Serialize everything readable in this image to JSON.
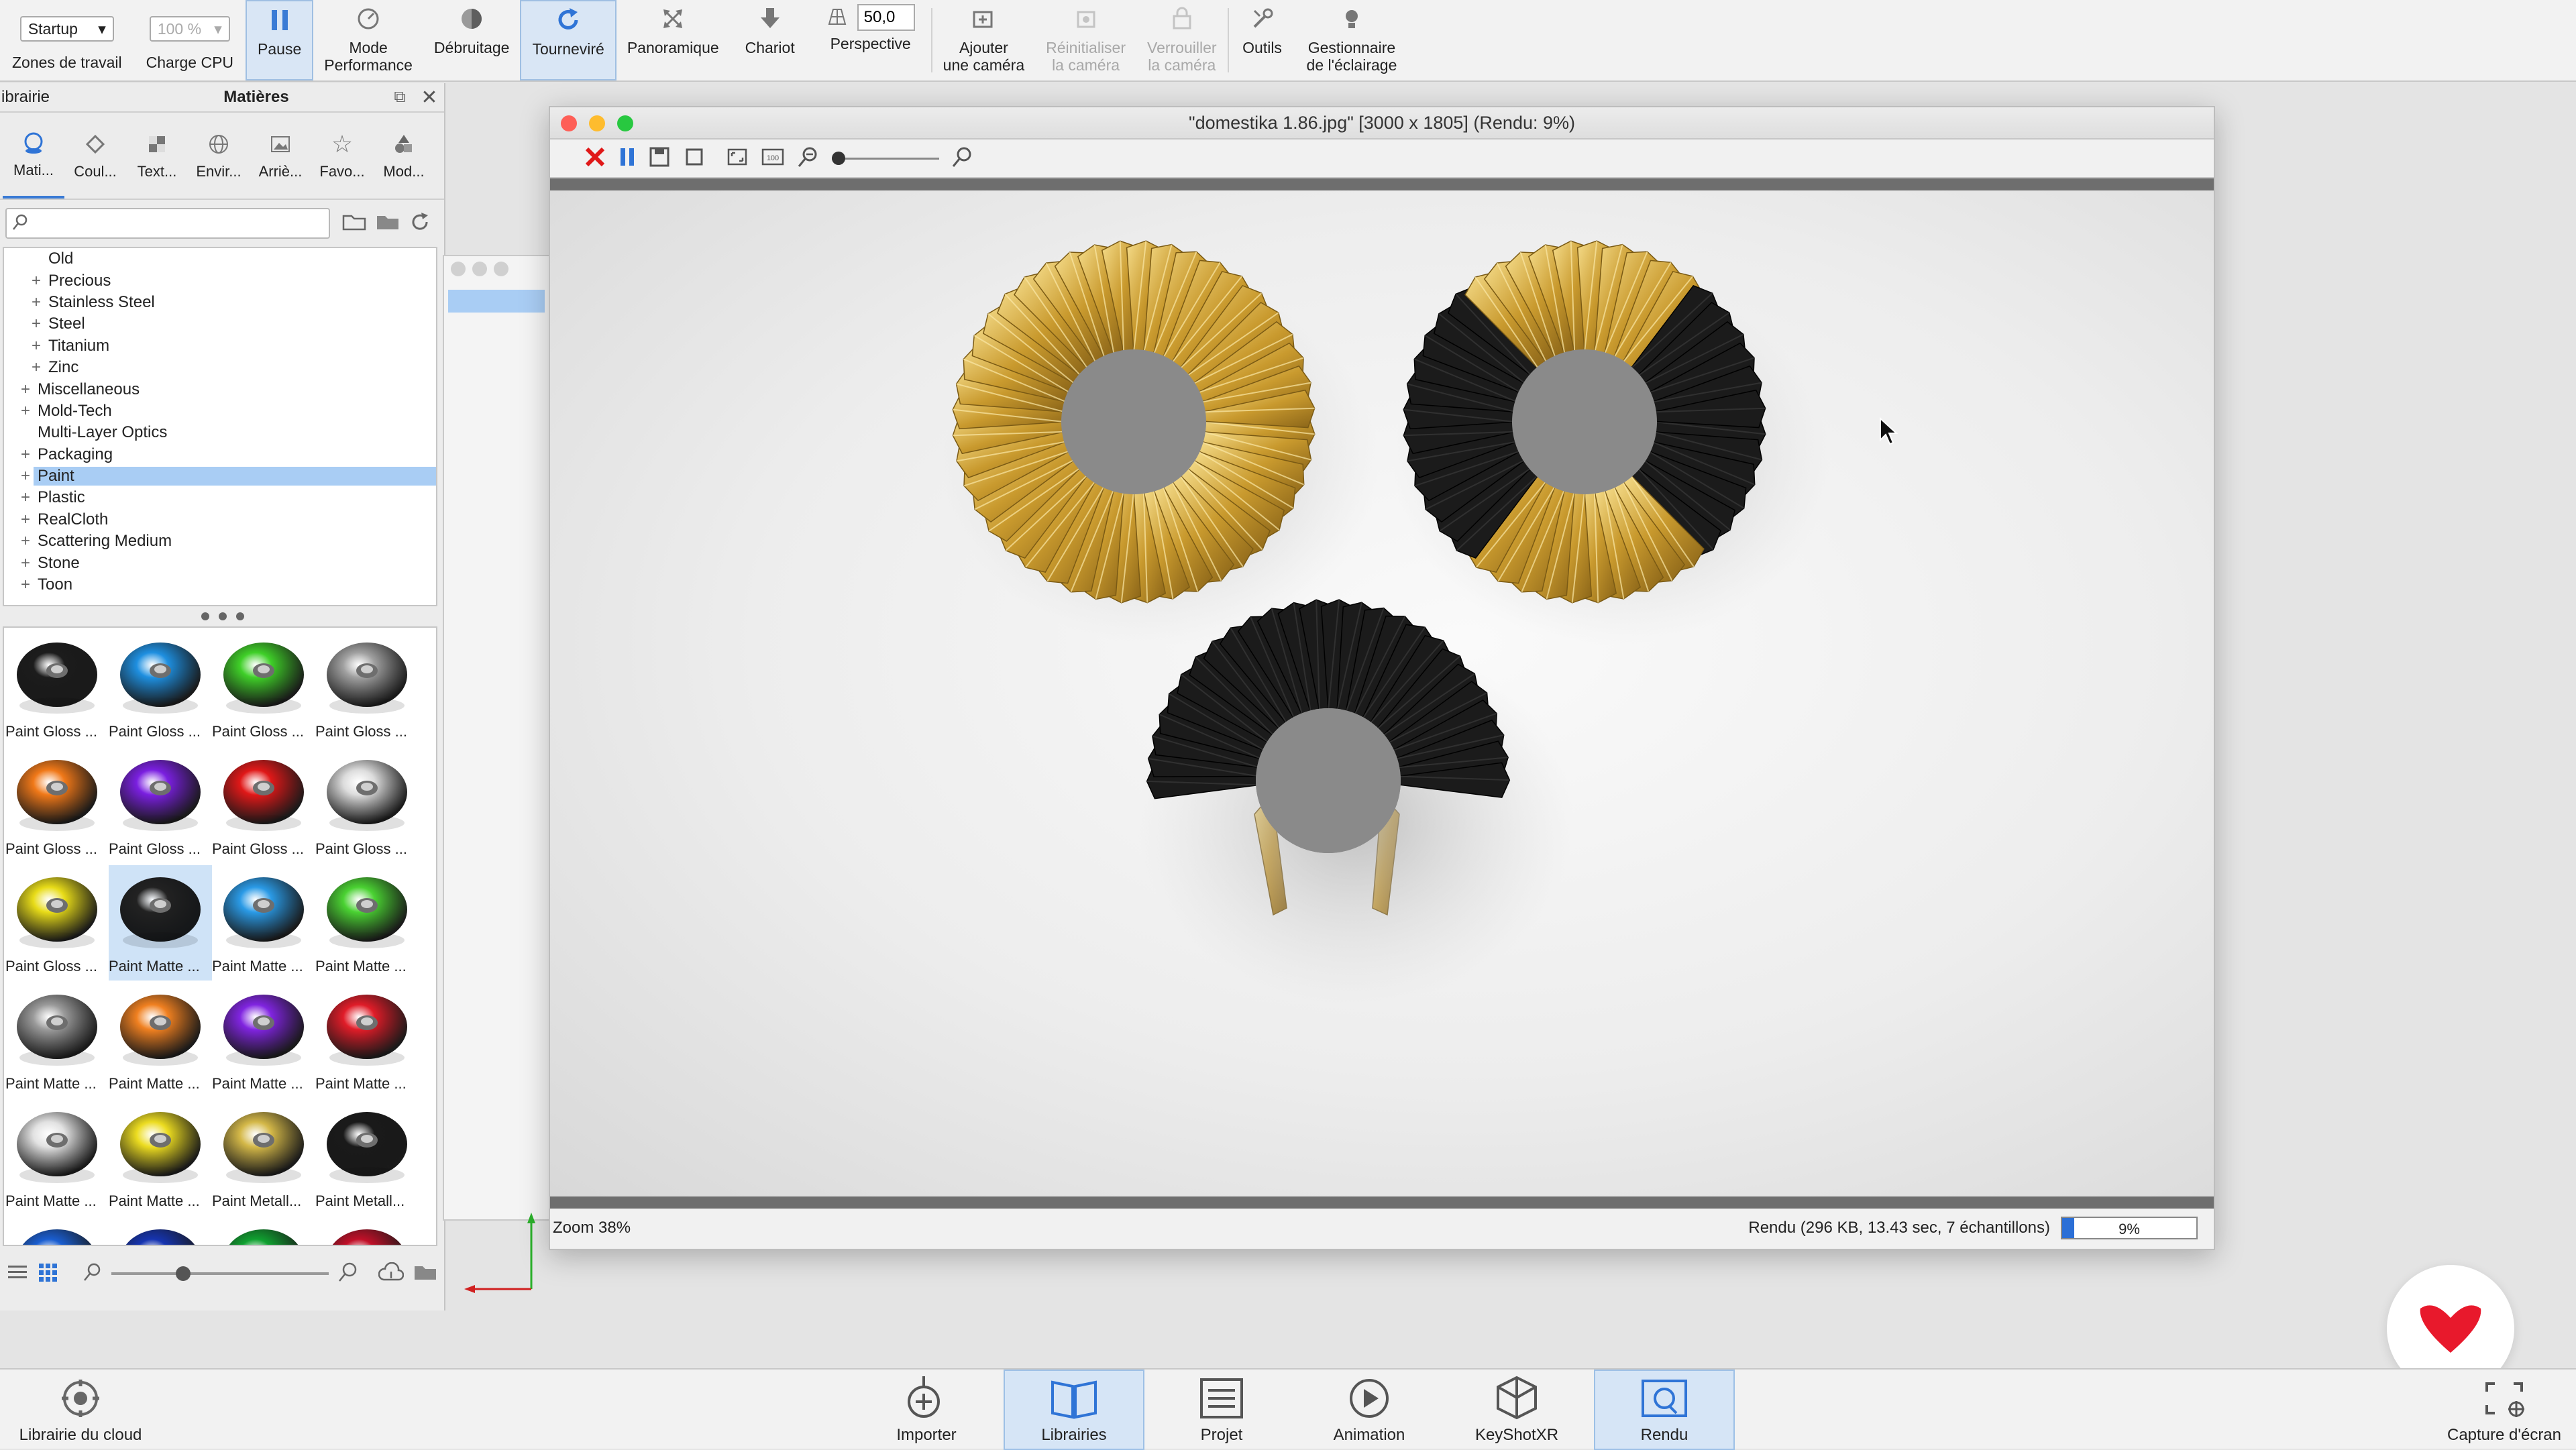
{
  "toolbar": {
    "workspace_select": "Startup",
    "workspace_label": "Zones de travail",
    "cpu_select": "100 %",
    "cpu_label": "Charge CPU",
    "pause": "Pause",
    "perf_mode_1": "Mode",
    "perf_mode_2": "Performance",
    "denoise": "Débruitage",
    "tumble": "Tourneviré",
    "pan": "Panoramique",
    "dolly": "Chariot",
    "perspective_value": "50,0",
    "perspective": "Perspective",
    "add_camera_1": "Ajouter",
    "add_camera_2": "une caméra",
    "reset_camera_1": "Réinitialiser",
    "reset_camera_2": "la caméra",
    "lock_camera_1": "Verrouiller",
    "lock_camera_2": "la caméra",
    "tools": "Outils",
    "lighting_1": "Gestionnaire",
    "lighting_2": "de l'éclairage"
  },
  "library": {
    "title": "ibrairie",
    "section": "Matières",
    "tabs": [
      "Mati...",
      "Coul...",
      "Text...",
      "Envir...",
      "Arriè...",
      "Favo...",
      "Mod..."
    ],
    "search_placeholder": "",
    "tree": [
      {
        "label": "Old",
        "level": 2,
        "expander": "",
        "selected": false
      },
      {
        "label": "Precious",
        "level": 2,
        "expander": "+",
        "selected": false
      },
      {
        "label": "Stainless Steel",
        "level": 2,
        "expander": "+",
        "selected": false
      },
      {
        "label": "Steel",
        "level": 2,
        "expander": "+",
        "selected": false
      },
      {
        "label": "Titanium",
        "level": 2,
        "expander": "+",
        "selected": false
      },
      {
        "label": "Zinc",
        "level": 2,
        "expander": "+",
        "selected": false
      },
      {
        "label": "Miscellaneous",
        "level": 1,
        "expander": "+",
        "selected": false
      },
      {
        "label": "Mold-Tech",
        "level": 1,
        "expander": "+",
        "selected": false
      },
      {
        "label": "Multi-Layer Optics",
        "level": 1,
        "expander": "",
        "selected": false
      },
      {
        "label": "Packaging",
        "level": 1,
        "expander": "+",
        "selected": false
      },
      {
        "label": "Paint",
        "level": 1,
        "expander": "+",
        "selected": true
      },
      {
        "label": "Plastic",
        "level": 1,
        "expander": "+",
        "selected": false
      },
      {
        "label": "RealCloth",
        "level": 1,
        "expander": "+",
        "selected": false
      },
      {
        "label": "Scattering Medium",
        "level": 1,
        "expander": "+",
        "selected": false
      },
      {
        "label": "Stone",
        "level": 1,
        "expander": "+",
        "selected": false
      },
      {
        "label": "Toon",
        "level": 1,
        "expander": "+",
        "selected": false
      }
    ],
    "materials": [
      {
        "label": "Paint Gloss ...",
        "color": "#1c1c1c"
      },
      {
        "label": "Paint Gloss ...",
        "color": "#1e8fe0"
      },
      {
        "label": "Paint Gloss ...",
        "color": "#3fcf28"
      },
      {
        "label": "Paint Gloss ...",
        "color": "#a0a0a0"
      },
      {
        "label": "Paint Gloss ...",
        "color": "#f07818"
      },
      {
        "label": "Paint Gloss ...",
        "color": "#7a1fe0"
      },
      {
        "label": "Paint Gloss ...",
        "color": "#e01818"
      },
      {
        "label": "Paint Gloss ...",
        "color": "#dcdcdc"
      },
      {
        "label": "Paint Gloss ...",
        "color": "#e8dc18"
      },
      {
        "label": "Paint Matte ...",
        "color": "#222222"
      },
      {
        "label": "Paint Matte ...",
        "color": "#2a9ae6"
      },
      {
        "label": "Paint Matte ...",
        "color": "#4ad232"
      },
      {
        "label": "Paint Matte ...",
        "color": "#9a9a9a"
      },
      {
        "label": "Paint Matte ...",
        "color": "#f08020"
      },
      {
        "label": "Paint Matte ...",
        "color": "#8024e0"
      },
      {
        "label": "Paint Matte ...",
        "color": "#e01c28"
      },
      {
        "label": "Paint Matte ...",
        "color": "#e2e2e2"
      },
      {
        "label": "Paint Matte ...",
        "color": "#ecdc20"
      },
      {
        "label": "Paint Metall...",
        "color": "#d4b848"
      },
      {
        "label": "Paint Metall...",
        "color": "#1a1a1a"
      },
      {
        "label": "",
        "color": "#1a5ed0"
      },
      {
        "label": "",
        "color": "#1634b0"
      },
      {
        "label": "",
        "color": "#10a030"
      },
      {
        "label": "",
        "color": "#c01028"
      }
    ],
    "selected_material_index": 9
  },
  "render_window": {
    "title": "\"domestika 1.86.jpg\" [3000 x 1805] (Rendu: 9%)",
    "zoom": "Zoom 38%",
    "status": "Rendu (296 KB, 13.43 sec, 7 échantillons)",
    "progress_text": "9%",
    "progress": 0.09
  },
  "bottombar": {
    "cloud": "Librairie du cloud",
    "import": "Importer",
    "libraries": "Librairies",
    "project": "Projet",
    "animation": "Animation",
    "keyshotxr": "KeyShotXR",
    "render": "Rendu",
    "screenshot": "Capture d'écran"
  },
  "colors": {
    "accent": "#3a7bd5",
    "selection": "#a9cdf4",
    "gold": "#d9b24a",
    "black_fan": "#1b1b1b",
    "brand_red": "#e8192c"
  }
}
